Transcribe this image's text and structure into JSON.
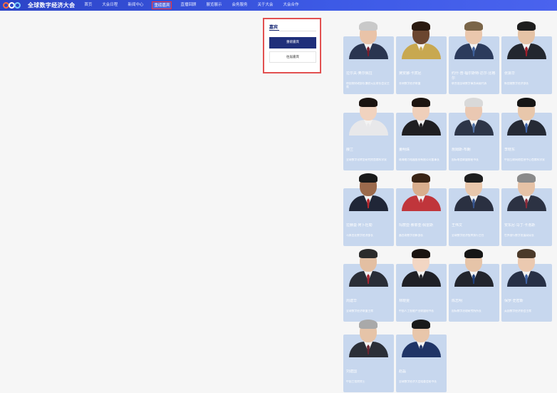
{
  "header": {
    "logo_text": "全球数字经济大会",
    "nav": [
      {
        "label": "首页",
        "active": false
      },
      {
        "label": "大会日程",
        "active": false
      },
      {
        "label": "新闻中心",
        "active": false
      },
      {
        "label": "重磅嘉宾",
        "active": true
      },
      {
        "label": "直播回顾",
        "active": false
      },
      {
        "label": "展览展示",
        "active": false
      },
      {
        "label": "会务服务",
        "active": false
      },
      {
        "label": "关于大会",
        "active": false
      },
      {
        "label": "大会合作",
        "active": false
      }
    ]
  },
  "filter": {
    "title": "嘉宾",
    "primary_label": "重磅嘉宾",
    "secondary_label": "往届嘉宾"
  },
  "speakers": [
    {
      "name": "拉尔夫·奥尔佩拉",
      "desc": "德国前财政部长兼欧元区财长会议主席",
      "skin": "#e9c3a8",
      "hair": "#c9c9c9",
      "suit": "#2a3550",
      "tie": "#7a1d2d"
    },
    {
      "name": "黛安娜·卡宾尼",
      "desc": "非洲数字经济联盟",
      "skin": "#6b4630",
      "hair": "#2b1a10",
      "suit": "#c8a850",
      "tie": "#c8a850"
    },
    {
      "name": "约什·普·福尔斯特·达尔·比格尔",
      "desc": "联合国全球数字事务高级代表",
      "skin": "#eac7ad",
      "hair": "#7a6548",
      "suit": "#2c3b5c",
      "tie": "#3e5f99"
    },
    {
      "name": "张振华",
      "desc": "新加坡数字经济部长",
      "skin": "#e5c3a6",
      "hair": "#1e1e1e",
      "suit": "#23272f",
      "tie": "#9d1e2a"
    },
    {
      "name": "薛兰",
      "desc": "全球数字化转型研究院首席科学家",
      "skin": "#f1d3bf",
      "hair": "#1b1410",
      "suit": "#e8e8ea",
      "tie": "#e8e8ea"
    },
    {
      "name": "董明珠",
      "desc": "珠海格力电器股份有限公司董事长",
      "skin": "#efcfba",
      "hair": "#1d1510",
      "suit": "#1f1f22",
      "tie": "#1f1f22"
    },
    {
      "name": "詹姆斯·布朗",
      "desc": "国际电信联盟前秘书长",
      "skin": "#eac8b2",
      "hair": "#d9d9d9",
      "suit": "#2d3548",
      "tie": "#4e6fa3"
    },
    {
      "name": "李晓东",
      "desc": "中国互联网络信息中心首席科学家",
      "skin": "#e8c7ab",
      "hair": "#161616",
      "suit": "#252a35",
      "tie": "#3d63a8"
    },
    {
      "name": "拉赫曼·阿卜杜勒",
      "desc": "马来西亚数字经济部长",
      "skin": "#9b6a4c",
      "hair": "#1a1a1a",
      "suit": "#202637",
      "tie": "#b8282e"
    },
    {
      "name": "玛丽亚·索菲亚·佩雷斯",
      "desc": "墨西哥数字创新部长",
      "skin": "#d9ae8d",
      "hair": "#3a2516",
      "suit": "#c0353b",
      "tie": "#c0353b"
    },
    {
      "name": "王伟文",
      "desc": "全球数字经济智库执行主任",
      "skin": "#e9c7ab",
      "hair": "#1e1e1e",
      "suit": "#2a3041",
      "tie": "#37558f"
    },
    {
      "name": "安东尼·马丁·卡洛斯",
      "desc": "世界银行数字发展局局长",
      "skin": "#e6c2a6",
      "hair": "#8a8a8a",
      "suit": "#2c3243",
      "tie": "#8b2b3a"
    },
    {
      "name": "周建华",
      "desc": "全球数字经济联盟主席",
      "skin": "#e3bfa2",
      "hair": "#2b2b2b",
      "suit": "#2a2e37",
      "tie": "#a32330"
    },
    {
      "name": "林晓雯",
      "desc": "中国人工智能产业联盟秘书长",
      "skin": "#f2d6c3",
      "hair": "#1b1410",
      "suit": "#1f2026",
      "tie": "#1f2026"
    },
    {
      "name": "陈志明",
      "desc": "国际数字治理研究所所长",
      "skin": "#e6c4a8",
      "hair": "#161616",
      "suit": "#22252d",
      "tie": "#1e3f7a"
    },
    {
      "name": "保罗·史密斯",
      "desc": "英国数字经济协会主席",
      "skin": "#ebc9b0",
      "hair": "#4b3a2a",
      "suit": "#273046",
      "tie": "#3e62a4"
    },
    {
      "name": "刘建国",
      "desc": "中国工程院院士",
      "skin": "#e6c4a8",
      "hair": "#a9a9a9",
      "suit": "#2b2f38",
      "tie": "#6b2532"
    },
    {
      "name": "赵磊",
      "desc": "全球数字经济大会组委会秘书长",
      "skin": "#e8c6aa",
      "hair": "#1a1a1a",
      "suit": "#1f3466",
      "tie": "#1f3466"
    }
  ]
}
